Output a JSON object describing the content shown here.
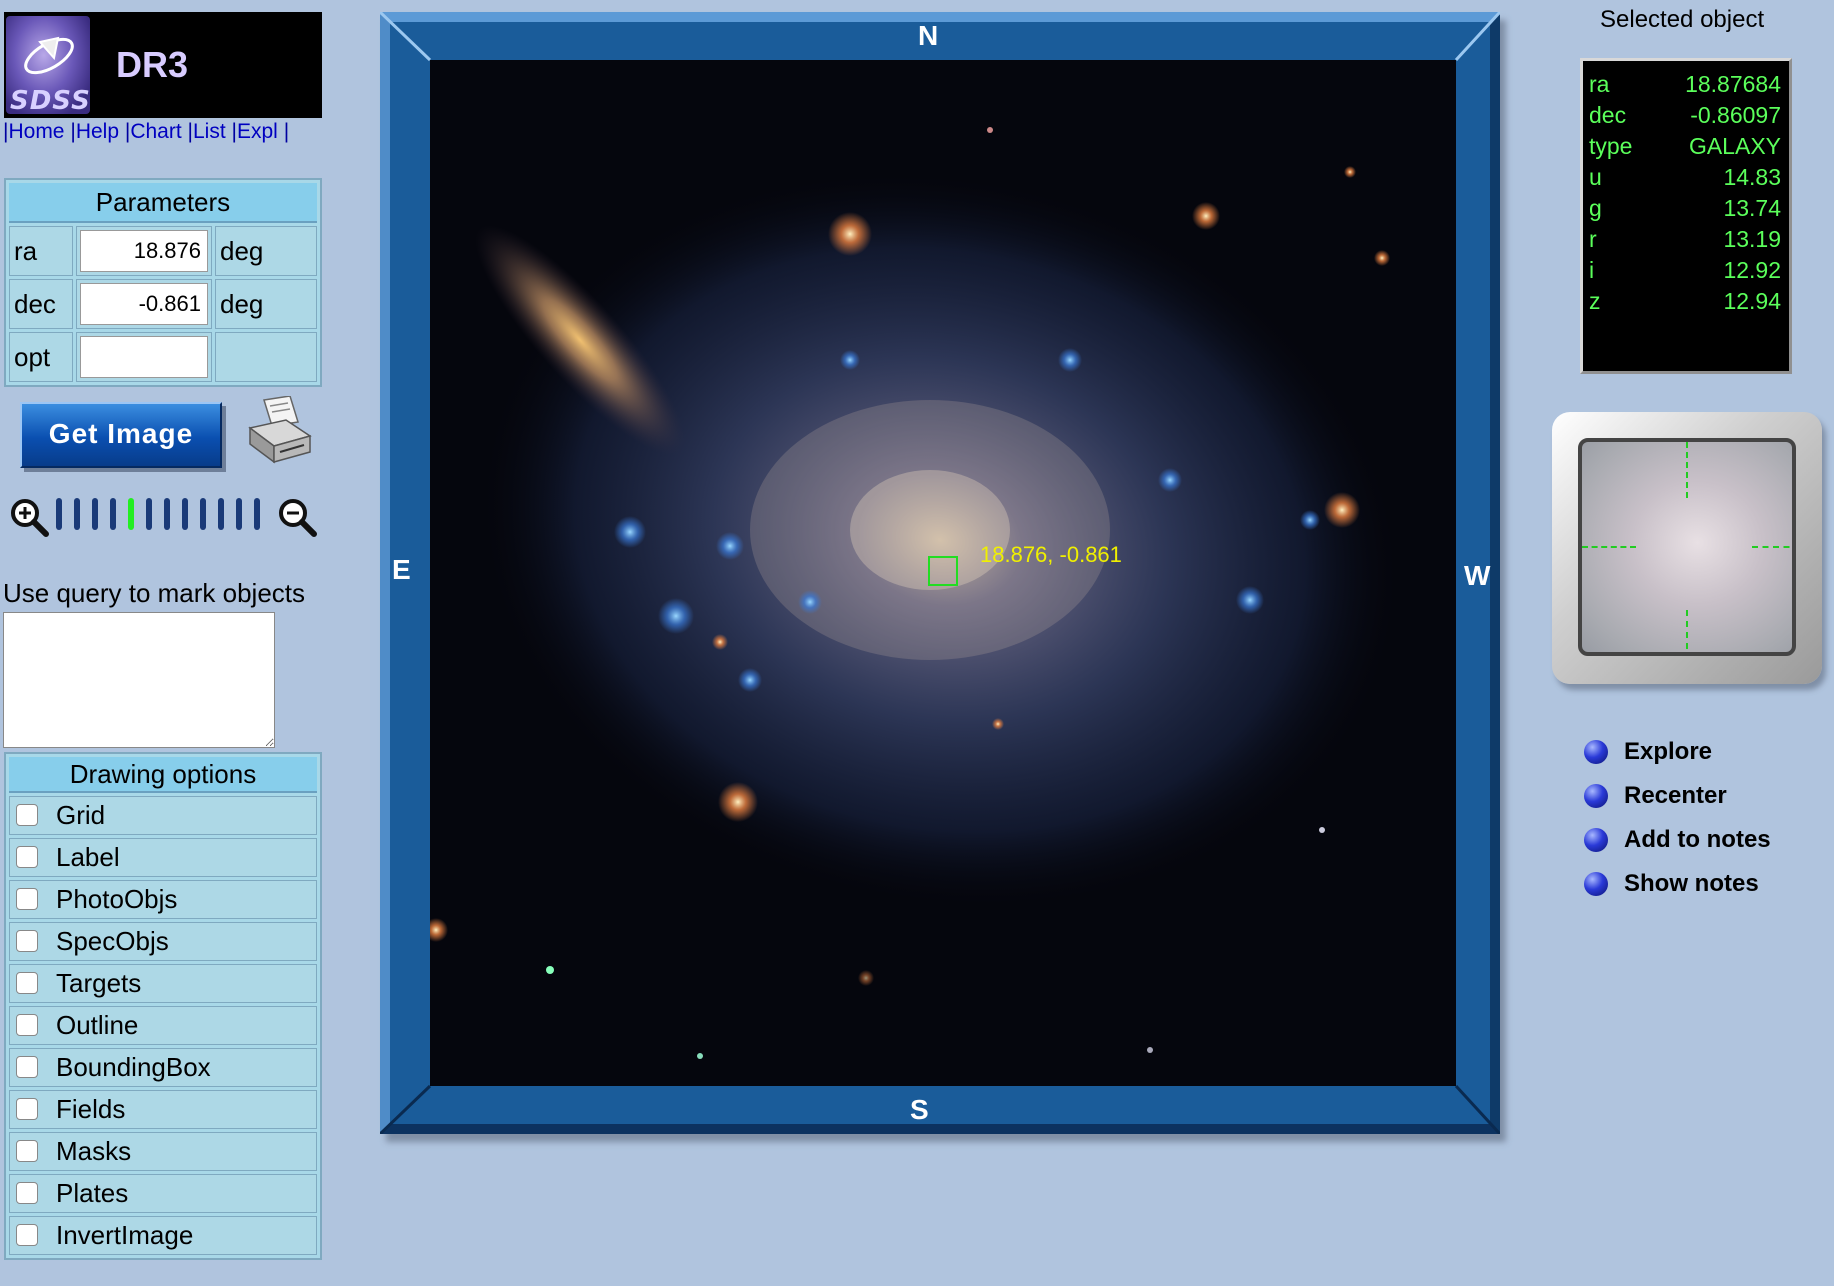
{
  "logo": {
    "brand": "SDSS",
    "release": "DR3"
  },
  "nav": {
    "separator": "|",
    "links": [
      "Home",
      "Help",
      "Chart",
      "List",
      "Expl"
    ]
  },
  "parameters": {
    "title": "Parameters",
    "rows": [
      {
        "label": "ra",
        "value": "18.876",
        "unit": "deg"
      },
      {
        "label": "dec",
        "value": "-0.861",
        "unit": "deg"
      },
      {
        "label": "opt",
        "value": "",
        "unit": ""
      }
    ]
  },
  "get_image_label": "Get Image",
  "zoom": {
    "steps": 12,
    "active_index": 4
  },
  "query": {
    "label": "Use query to mark objects",
    "value": ""
  },
  "drawing_options": {
    "title": "Drawing options",
    "items": [
      "Grid",
      "Label",
      "PhotoObjs",
      "SpecObjs",
      "Targets",
      "Outline",
      "BoundingBox",
      "Fields",
      "Masks",
      "Plates",
      "InvertImage"
    ]
  },
  "compass": {
    "north": "N",
    "south": "S",
    "east": "E",
    "west": "W"
  },
  "image": {
    "coord_label": "18.876, -0.861"
  },
  "selected_object": {
    "title": "Selected object",
    "fields": [
      {
        "key": "ra",
        "value": "18.87684"
      },
      {
        "key": "dec",
        "value": "-0.86097"
      },
      {
        "key": "type",
        "value": "GALAXY"
      },
      {
        "key": "u",
        "value": "14.83"
      },
      {
        "key": "g",
        "value": "13.74"
      },
      {
        "key": "r",
        "value": "13.19"
      },
      {
        "key": "i",
        "value": "12.92"
      },
      {
        "key": "z",
        "value": "12.94"
      }
    ]
  },
  "actions": [
    "Explore",
    "Recenter",
    "Add to notes",
    "Show notes"
  ],
  "colors": {
    "background": "#b0c4de",
    "panel": "#add8e6",
    "frame": "#1a5c9a",
    "info_text": "#5bff5b",
    "coord_label": "#f0f000",
    "marker": "#22dd22"
  }
}
